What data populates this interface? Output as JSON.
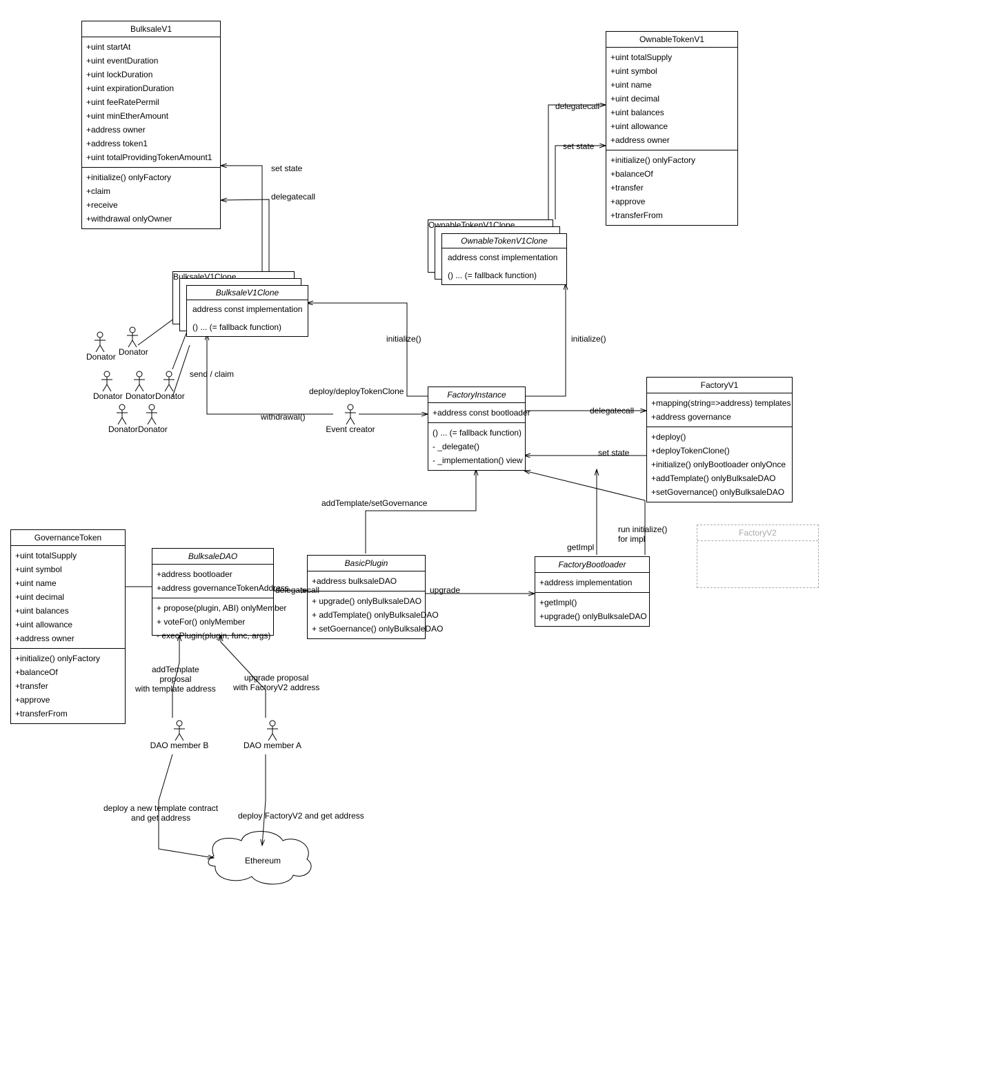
{
  "classes": {
    "BulksaleV1": {
      "title": "BulksaleV1",
      "attrs": [
        "+uint startAt",
        "+uint eventDuration",
        "+uint lockDuration",
        "+uint expirationDuration",
        "+uint feeRatePermil",
        "+uint minEtherAmount",
        "+address owner",
        "+address token1",
        "+uint totalProvidingTokenAmount1"
      ],
      "ops": [
        "+initialize() onlyFactory",
        "+claim",
        "+receive",
        "+withdrawal onlyOwner"
      ]
    },
    "OwnableTokenV1": {
      "title": "OwnableTokenV1",
      "attrs": [
        "+uint totalSupply",
        "+uint symbol",
        "+uint name",
        "+uint decimal",
        "+uint balances",
        "+uint allowance",
        "+address owner"
      ],
      "ops": [
        "+initialize() onlyFactory",
        "+balanceOf",
        "+transfer",
        "+approve",
        "+transferFrom"
      ]
    },
    "GovernanceToken": {
      "title": "GovernanceToken",
      "attrs": [
        "+uint totalSupply",
        "+uint symbol",
        "+uint name",
        "+uint decimal",
        "+uint balances",
        "+uint allowance",
        "+address owner"
      ],
      "ops": [
        "+initialize() onlyFactory",
        "+balanceOf",
        "+transfer",
        "+approve",
        "+transferFrom"
      ]
    },
    "BulksaleDAO": {
      "title": "BulksaleDAO",
      "attrs": [
        "+address bootloader",
        "+address governanceTokenAddress"
      ],
      "ops": [
        "+ propose(plugin, ABI) onlyMember",
        "+ voteFor() onlyMember",
        "- execPlugin(plugin, func, args)"
      ]
    },
    "BasicPlugin": {
      "title": "BasicPlugin",
      "attrs": [
        "+address bulksaleDAO"
      ],
      "ops": [
        "+ upgrade() onlyBulksaleDAO",
        "+ addTemplate() onlyBulksaleDAO",
        "+ setGoernance() onlyBulksaleDAO"
      ]
    },
    "FactoryBootloader": {
      "title": "FactoryBootloader",
      "attrs": [
        "+address implementation"
      ],
      "ops": [
        "+getImpl()",
        "+upgrade() onlyBulksaleDAO"
      ]
    },
    "FactoryInstance": {
      "title": "FactoryInstance",
      "attrs": [
        "+address const bootloader"
      ],
      "ops": [
        "() ... (= fallback function)",
        "- _delegate()",
        "- _implementation() view"
      ]
    },
    "FactoryV1": {
      "title": "FactoryV1",
      "attrs": [
        "+mapping(string=>address) templates",
        "+address governance"
      ],
      "ops": [
        "+deploy()",
        "+deployTokenClone()",
        "+initialize() onlyBootloader onlyOnce",
        "+addTemplate() onlyBulksaleDAO",
        "+setGovernance() onlyBulksaleDAO"
      ]
    },
    "FactoryV2": {
      "title": "FactoryV2"
    }
  },
  "clones": {
    "BulksaleV1Clone": {
      "title": "BulksaleV1Clone",
      "attr": "address const implementation",
      "op": "() ... (= fallback function)"
    },
    "OwnableTokenV1Clone": {
      "title": "OwnableTokenV1Clone",
      "attr": "address const implementation",
      "op": "() ... (= fallback function)"
    }
  },
  "actors": {
    "Donator": "Donator",
    "EventCreator": "Event creator",
    "DAOA": "DAO member A",
    "DAOB": "DAO member B"
  },
  "labels": {
    "setstate1": "set state",
    "delegatecall1": "delegatecall",
    "delegatecall2": "delegatecall",
    "setstate2": "set state",
    "initialize1": "initialize()",
    "initialize2": "initialize()",
    "sendclaim": "send / claim",
    "withdrawal": "withdrawal()",
    "deploydeploy": "deploy/deployTokenClone",
    "delegatecall3": "delegatecall",
    "setstate3": "set state",
    "addTemplate": "addTemplate/setGovernance",
    "upgrade": "upgrade",
    "getImpl": "getImpl",
    "runinit": "run initialize()\nfor impl",
    "delegatecall4": "delegatecall",
    "addTmplProp": "addTemplate\nproposal\nwith template address",
    "upgradeProp": "upgrade proposal\nwith FactoryV2 address",
    "deployNew": "deploy a new template contract\nand get address",
    "deployV2": "deploy FactoryV2 and get address",
    "ethereum": "Ethereum"
  }
}
